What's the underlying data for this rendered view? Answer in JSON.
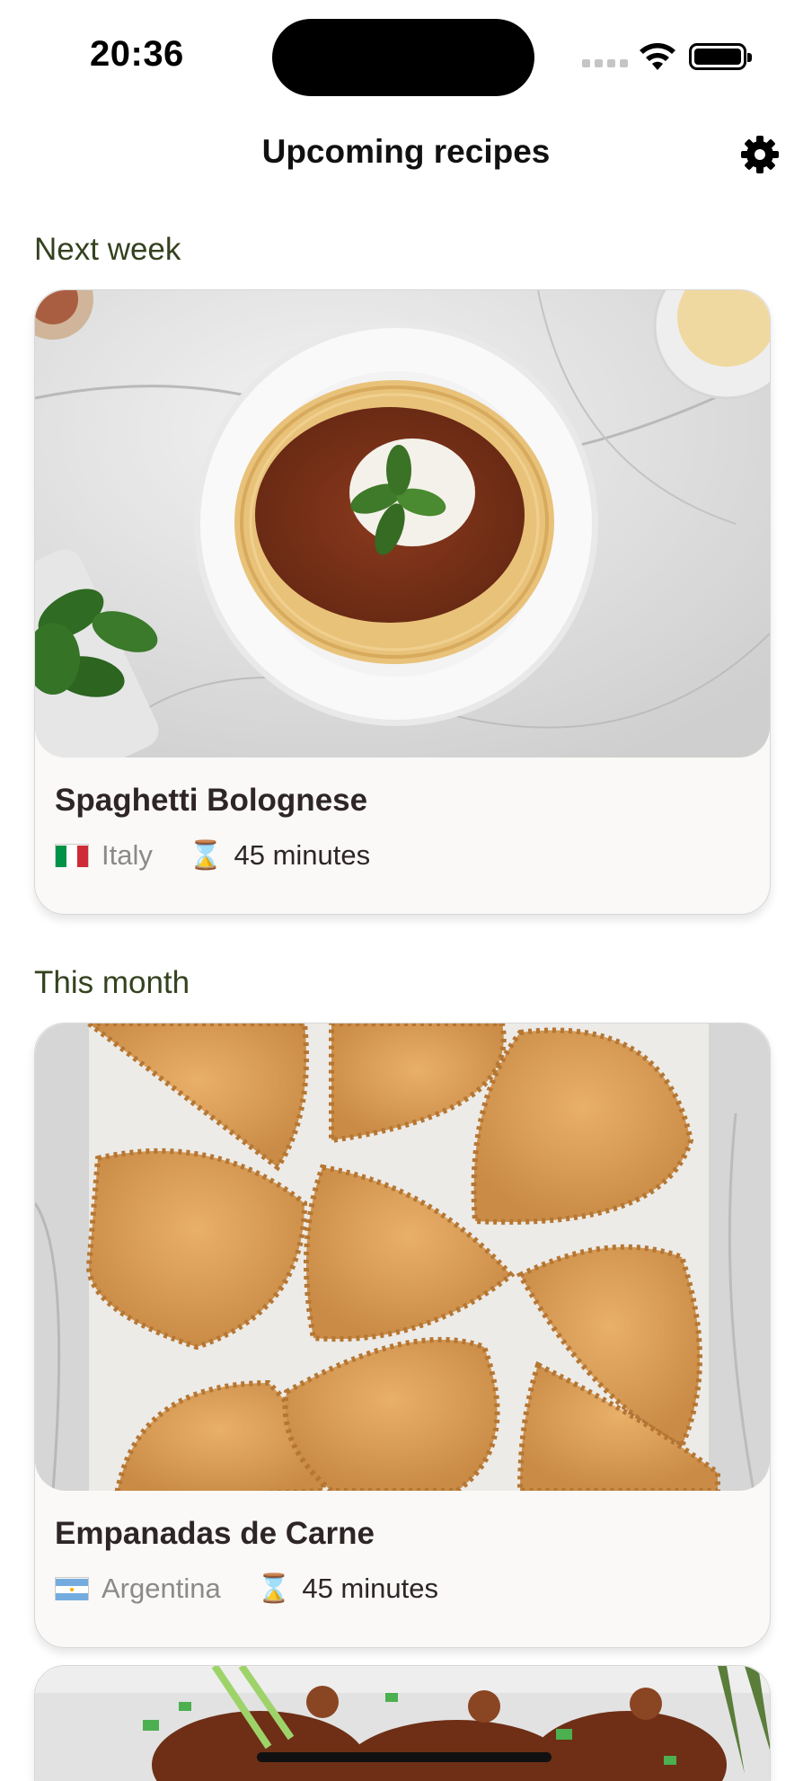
{
  "status_bar": {
    "time": "20:36"
  },
  "header": {
    "title": "Upcoming recipes",
    "settings_icon": "gear-icon"
  },
  "sections": [
    {
      "label": "Next week",
      "recipe": {
        "name": "Spaghetti Bolognese",
        "country": "Italy",
        "flag": "italy-flag-icon",
        "duration": "45 minutes",
        "time_icon": "hourglass-icon"
      }
    },
    {
      "label": "This month",
      "recipe": {
        "name": "Empanadas de Carne",
        "country": "Argentina",
        "flag": "argentina-flag-icon",
        "duration": "45 minutes",
        "time_icon": "hourglass-icon"
      }
    }
  ],
  "colors": {
    "section_label": "#34421f",
    "card_background": "#faf9f7",
    "country_text": "#8a8a8a"
  }
}
